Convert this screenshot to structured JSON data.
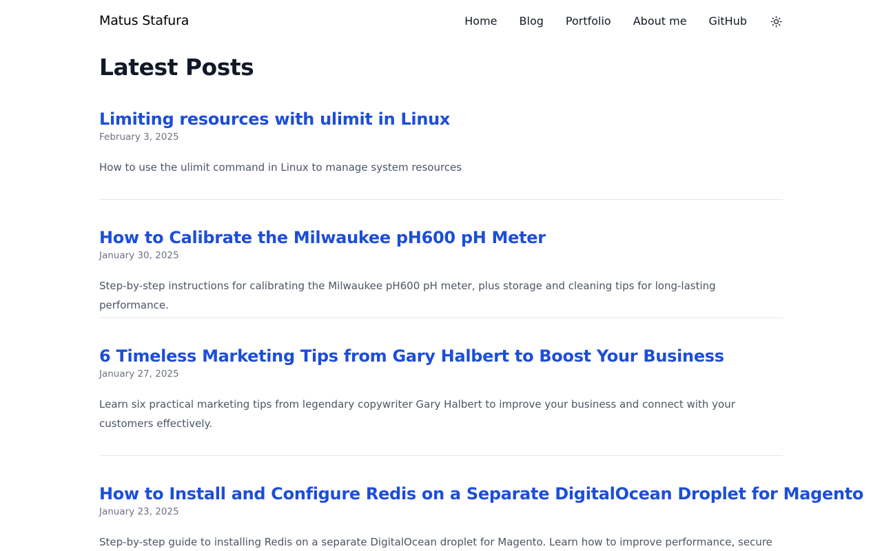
{
  "header": {
    "site_title": "Matus Stafura",
    "nav": {
      "home": "Home",
      "blog": "Blog",
      "portfolio": "Portfolio",
      "about": "About me",
      "github": "GitHub"
    },
    "theme_icon": "sun-icon"
  },
  "main": {
    "heading": "Latest Posts",
    "posts": [
      {
        "title": "Limiting resources with ulimit in Linux",
        "date": "February 3, 2025",
        "description": "How to use the ulimit command in Linux to manage system resources"
      },
      {
        "title": "How to Calibrate the Milwaukee pH600 pH Meter",
        "date": "January 30, 2025",
        "description": "Step-by-step instructions for calibrating the Milwaukee pH600 pH meter, plus storage and cleaning tips for long-lasting performance."
      },
      {
        "title": "6 Timeless Marketing Tips from Gary Halbert to Boost Your Business",
        "date": "January 27, 2025",
        "description": "Learn six practical marketing tips from legendary copywriter Gary Halbert to improve your business and connect with your customers effectively."
      },
      {
        "title": "How to Install and Configure Redis on a Separate DigitalOcean Droplet for Magento",
        "date": "January 23, 2025",
        "description": "Step-by-step guide to installing Redis on a separate DigitalOcean droplet for Magento. Learn how to improve performance, secure Redis"
      }
    ]
  },
  "colors": {
    "link": "#1d4ed8",
    "text": "#111827",
    "muted": "#6b7280",
    "body_text": "#4b5563",
    "divider": "#e5e7eb"
  }
}
